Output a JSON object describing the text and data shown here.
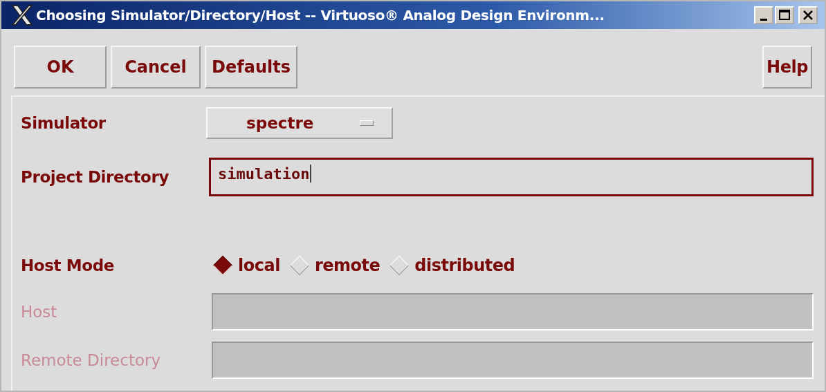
{
  "window": {
    "title": "Choosing Simulator/Directory/Host -- Virtuoso® Analog Design Environm..."
  },
  "buttons": [
    {
      "label": "OK"
    },
    {
      "label": "Cancel"
    },
    {
      "label": "Defaults"
    }
  ],
  "help_button": {
    "label": "Help"
  },
  "simulator": {
    "label": "Simulator",
    "value": "spectre"
  },
  "project_directory": {
    "label": "Project Directory",
    "value": "simulation",
    "focused": true
  },
  "host_mode": {
    "label": "Host Mode",
    "options": [
      {
        "label": "local",
        "selected": true
      },
      {
        "label": "remote",
        "selected": false
      },
      {
        "label": "distributed",
        "selected": false
      }
    ]
  },
  "host": {
    "label": "Host",
    "disabled": true
  },
  "remote_directory": {
    "label": "Remote Directory",
    "disabled": true
  }
}
